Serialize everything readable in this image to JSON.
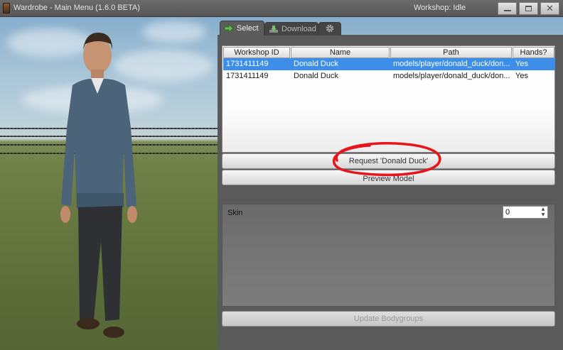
{
  "window": {
    "title": "Wardrobe - Main Menu (1.6.0 BETA)",
    "status": "Workshop: Idle",
    "controls": {
      "minimize": "▭",
      "maximize": "□",
      "close": "✕"
    }
  },
  "tabs": [
    {
      "label": "Select",
      "icon": "arrow-right-icon",
      "active": true
    },
    {
      "label": "Download",
      "icon": "download-icon",
      "active": false
    },
    {
      "label": "",
      "icon": "gear-icon",
      "active": false
    }
  ],
  "table": {
    "columns": [
      "Workshop ID",
      "Name",
      "Path",
      "Hands?"
    ],
    "rows": [
      {
        "workshop_id": "1731411149",
        "name": "Donald Duck",
        "path": "models/player/donald_duck/don...",
        "hands": "Yes",
        "selected": true
      },
      {
        "workshop_id": "1731411149",
        "name": "Donald Duck",
        "path": "models/player/donald_duck/don...",
        "hands": "Yes",
        "selected": false
      }
    ]
  },
  "buttons": {
    "request": "Request 'Donald Duck'",
    "preview": "Preview Model",
    "update_bodygroups": "Update Bodygroups"
  },
  "skin": {
    "label": "Skin",
    "value": "0"
  },
  "colors": {
    "selection": "#3d8ee8",
    "annotation": "#e8141b",
    "panel": "#5a5a5a"
  }
}
